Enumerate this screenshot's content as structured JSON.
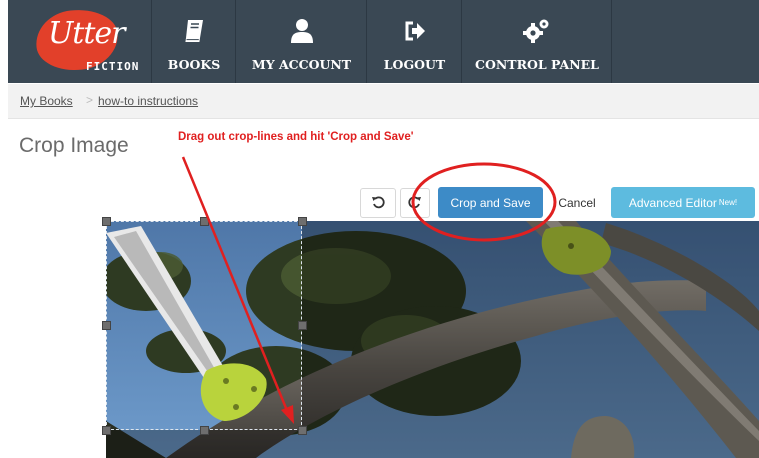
{
  "app": {
    "logo_main": "Utter",
    "logo_sub": "FICTION"
  },
  "nav": {
    "items": [
      {
        "label": "BOOKS",
        "icon": "book-icon"
      },
      {
        "label": "MY ACCOUNT",
        "icon": "user-icon"
      },
      {
        "label": "LOGOUT",
        "icon": "logout-icon"
      },
      {
        "label": "CONTROL PANEL",
        "icon": "gears-icon"
      }
    ]
  },
  "breadcrumb": {
    "items": [
      "My Books",
      "how-to instructions"
    ],
    "separator": ">"
  },
  "page": {
    "title": "Crop Image"
  },
  "annotation": {
    "instruction": "Drag out crop-lines and hit 'Crop and Save'",
    "color": "#e02020"
  },
  "toolbar": {
    "undo_icon": "rotate-left-icon",
    "redo_icon": "rotate-right-icon",
    "crop_save_label": "Crop and Save",
    "cancel_label": "Cancel",
    "advanced_label": "Advanced Editor",
    "advanced_badge": "New!"
  },
  "colors": {
    "navbar": "#3a4854",
    "logo": "#e2402a",
    "primary_button": "#3d8bc7",
    "advanced_button": "#5dbbdf"
  }
}
